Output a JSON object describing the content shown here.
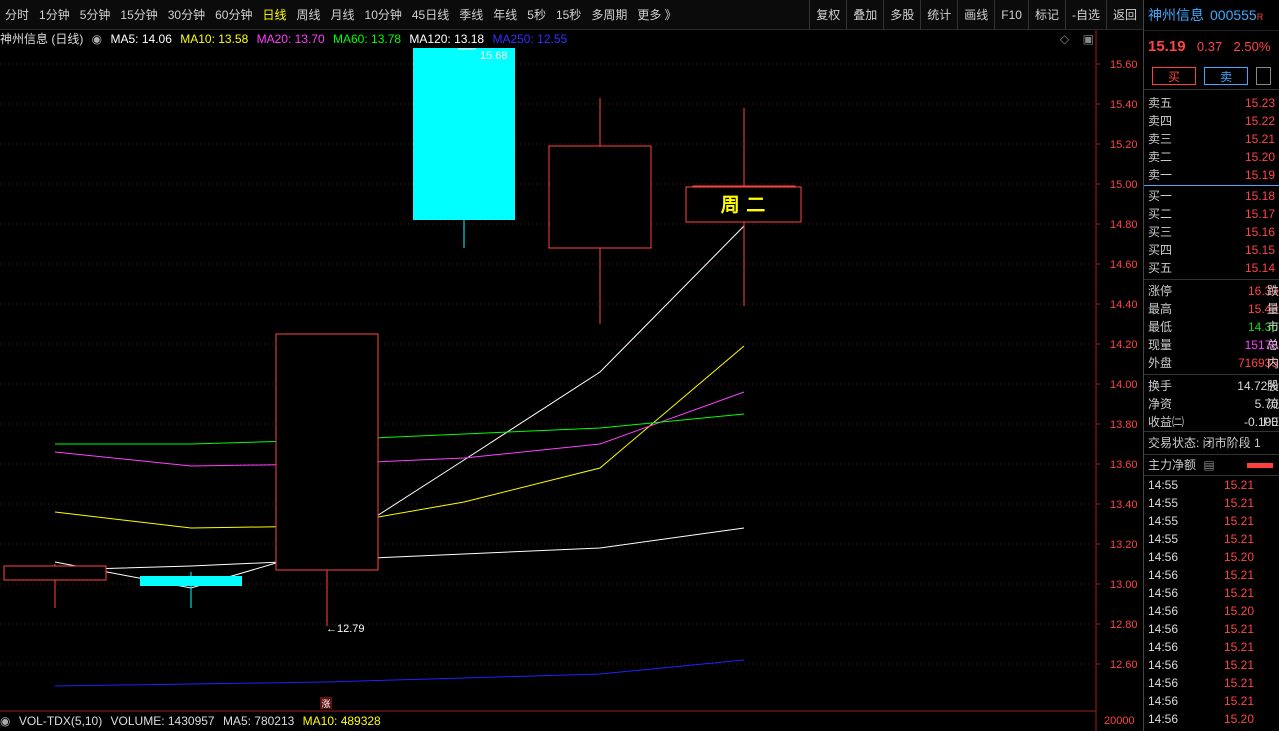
{
  "toolbar": {
    "periods": [
      "分时",
      "1分钟",
      "5分钟",
      "15分钟",
      "30分钟",
      "60分钟",
      "日线",
      "周线",
      "月线",
      "10分钟",
      "45日线",
      "季线",
      "年线",
      "5秒",
      "15秒",
      "多周期",
      "更多 》"
    ],
    "active_period": "日线",
    "tools": [
      "复权",
      "叠加",
      "多股",
      "统计",
      "画线",
      "F10",
      "标记",
      "-自选",
      "返回"
    ]
  },
  "ma_bar": {
    "title": "神州信息 (日线)",
    "ma5": "MA5: 14.06",
    "ma10": "MA10: 13.58",
    "ma20": "MA20: 13.70",
    "ma60": "MA60: 13.78",
    "ma120": "MA120: 13.18",
    "ma250": "MA250: 12.55"
  },
  "colors": {
    "up": "#ff4444",
    "down": "#00ffff",
    "ma5": "#ffffff",
    "ma10": "#ffff00",
    "ma20": "#ff40ff",
    "ma60": "#00ff00",
    "ma120": "#ffffff",
    "ma250": "#2020ff"
  },
  "chart_data": {
    "type": "candlestick",
    "ylim": [
      12.4,
      15.7
    ],
    "y_ticks": [
      "15.60",
      "15.40",
      "15.20",
      "15.00",
      "14.80",
      "14.60",
      "14.40",
      "14.20",
      "14.00",
      "13.80",
      "13.60",
      "13.40",
      "13.20",
      "13.00",
      "12.80",
      "12.60"
    ],
    "candles": [
      {
        "open": 13.02,
        "high": 13.1,
        "low": 12.88,
        "close": 13.09
      },
      {
        "open": 13.04,
        "high": 13.06,
        "low": 12.88,
        "close": 12.99
      },
      {
        "open": 13.07,
        "high": 14.25,
        "low": 12.79,
        "close": 14.25
      },
      {
        "open": 15.68,
        "high": 15.68,
        "low": 14.68,
        "close": 14.82
      },
      {
        "open": 14.68,
        "high": 15.43,
        "low": 14.3,
        "close": 15.19
      },
      {
        "open": 14.81,
        "high": 15.38,
        "low": 14.39,
        "close": 14.99
      }
    ],
    "ma_series": [
      {
        "name": "MA5",
        "values": [
          13.11,
          12.98,
          13.18,
          13.62,
          14.06,
          14.79
        ]
      },
      {
        "name": "MA10",
        "values": [
          13.36,
          13.28,
          13.29,
          13.41,
          13.58,
          14.19
        ]
      },
      {
        "name": "MA20",
        "values": [
          13.66,
          13.59,
          13.6,
          13.63,
          13.7,
          13.96
        ]
      },
      {
        "name": "MA60",
        "values": [
          13.7,
          13.7,
          13.72,
          13.75,
          13.78,
          13.85
        ]
      },
      {
        "name": "MA120",
        "values": [
          13.07,
          13.09,
          13.12,
          13.15,
          13.18,
          13.28
        ]
      },
      {
        "name": "MA250",
        "values": [
          12.49,
          12.5,
          12.51,
          12.53,
          12.55,
          12.62
        ]
      }
    ],
    "annotations": {
      "high_label": "15.68",
      "low_label": "←12.79",
      "weekday": "周 二",
      "zhang": "涨"
    }
  },
  "vol_bar": {
    "title": "VOL-TDX(5,10)",
    "volume": "VOLUME: 1430957",
    "ma5": "MA5: 780213",
    "ma10": "MA10: 489328",
    "axis_label": "20000"
  },
  "panel": {
    "name": "神州信息",
    "code": "000555",
    "r_mark": "R",
    "price": "15.19",
    "change": "0.37",
    "pct": "2.50%",
    "buy": "买",
    "sell": "卖",
    "asks": [
      {
        "label": "卖五",
        "price": "15.23"
      },
      {
        "label": "卖四",
        "price": "15.22"
      },
      {
        "label": "卖三",
        "price": "15.21"
      },
      {
        "label": "卖二",
        "price": "15.20"
      },
      {
        "label": "卖一",
        "price": "15.19"
      }
    ],
    "bids": [
      {
        "label": "买一",
        "price": "15.18"
      },
      {
        "label": "买二",
        "price": "15.17"
      },
      {
        "label": "买三",
        "price": "15.16"
      },
      {
        "label": "买四",
        "price": "15.15"
      },
      {
        "label": "买五",
        "price": "15.14"
      }
    ],
    "stats1": [
      {
        "label": "涨停",
        "value": "16.30",
        "x": "跌"
      },
      {
        "label": "最高",
        "value": "15.43",
        "x": "量"
      },
      {
        "label": "最低",
        "value": "14.30",
        "x": "市"
      },
      {
        "label": "现量",
        "value": "15178",
        "x": "总"
      },
      {
        "label": "外盘",
        "value": "716935",
        "x": "内"
      }
    ],
    "stats2": [
      {
        "label": "换手",
        "value": "14.72%",
        "x": "股"
      },
      {
        "label": "净资",
        "value": "5.70",
        "x": "流"
      },
      {
        "label": "收益㈡",
        "value": "-0.100",
        "x": "PE"
      }
    ],
    "state": "交易状态: 闭市阶段 1",
    "netflow": "主力净额",
    "ticks": [
      {
        "t": "14:55",
        "p": "15.21"
      },
      {
        "t": "14:55",
        "p": "15.21"
      },
      {
        "t": "14:55",
        "p": "15.21"
      },
      {
        "t": "14:55",
        "p": "15.21"
      },
      {
        "t": "14:56",
        "p": "15.20"
      },
      {
        "t": "14:56",
        "p": "15.21"
      },
      {
        "t": "14:56",
        "p": "15.21"
      },
      {
        "t": "14:56",
        "p": "15.20"
      },
      {
        "t": "14:56",
        "p": "15.21"
      },
      {
        "t": "14:56",
        "p": "15.21"
      },
      {
        "t": "14:56",
        "p": "15.21"
      },
      {
        "t": "14:56",
        "p": "15.21"
      },
      {
        "t": "14:56",
        "p": "15.21"
      },
      {
        "t": "14:56",
        "p": "15.20"
      }
    ]
  }
}
